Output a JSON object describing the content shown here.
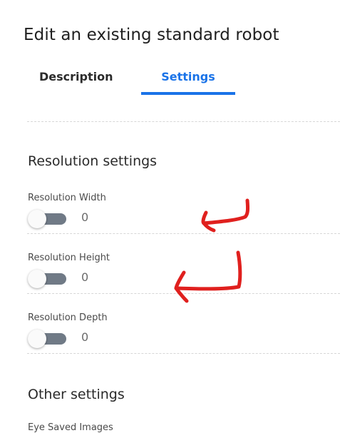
{
  "header": {
    "title": "Edit an existing standard robot"
  },
  "tabs": [
    {
      "label": "Description",
      "active": false
    },
    {
      "label": "Settings",
      "active": true
    }
  ],
  "accent_color": "#1a73e8",
  "annotation_color": "#e0201e",
  "resolution_section": {
    "title": "Resolution settings",
    "fields": [
      {
        "label": "Resolution Width",
        "value": "0",
        "enabled": false
      },
      {
        "label": "Resolution Height",
        "value": "0",
        "enabled": false
      },
      {
        "label": "Resolution Depth",
        "value": "0",
        "enabled": false
      }
    ]
  },
  "other_section": {
    "title": "Other settings",
    "first_field_label": "Eye Saved Images"
  }
}
